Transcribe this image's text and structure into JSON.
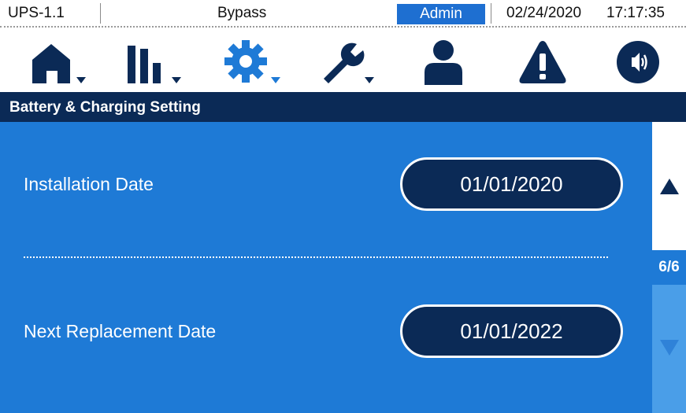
{
  "status": {
    "device": "UPS-1.1",
    "mode": "Bypass",
    "user": "Admin",
    "date": "02/24/2020",
    "time": "17:17:35"
  },
  "nav": {
    "icons": [
      "home-icon",
      "measurements-icon",
      "settings-icon",
      "maintenance-icon",
      "user-icon",
      "alarm-icon",
      "sound-icon"
    ],
    "active": "settings-icon"
  },
  "section": {
    "title": "Battery & Charging Setting"
  },
  "settings": [
    {
      "label": "Installation Date",
      "value": "01/01/2020"
    },
    {
      "label": "Next Replacement Date",
      "value": "01/01/2022"
    }
  ],
  "pager": {
    "indicator": "6/6"
  },
  "colors": {
    "navy": "#0b2a56",
    "accent": "#1e7ad6",
    "admin_badge": "#1e6fd1",
    "scroll_down_bg": "#4a9ee8"
  }
}
